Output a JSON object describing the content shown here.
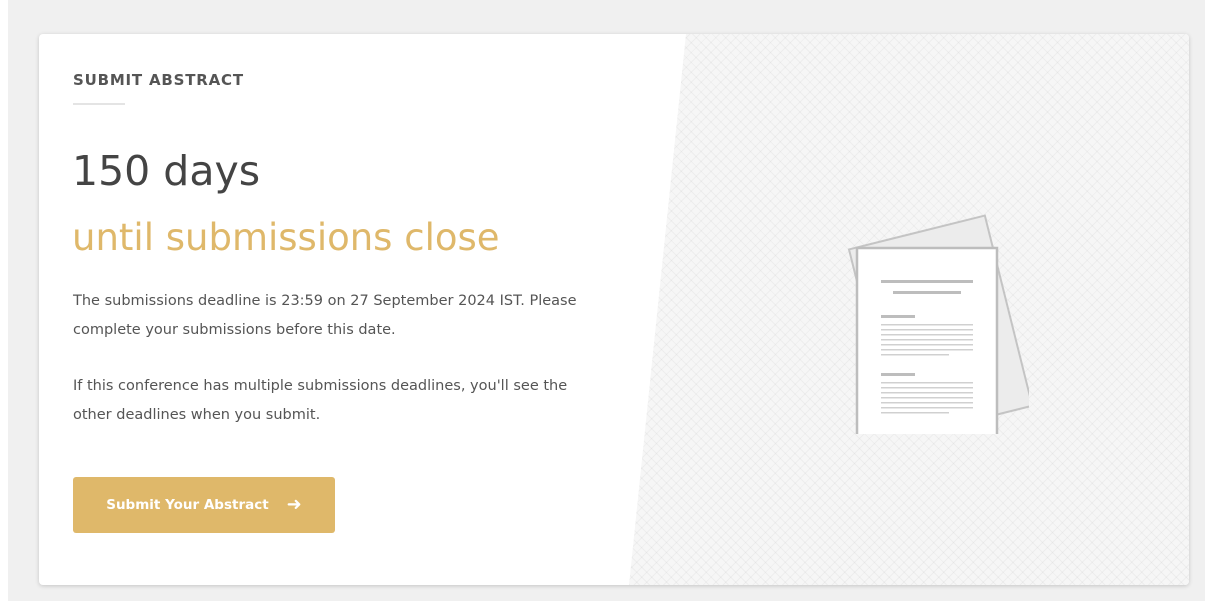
{
  "card": {
    "eyebrow": "SUBMIT ABSTRACT",
    "headline": "150 days",
    "subhead": "until submissions close",
    "paragraphs": [
      "The submissions deadline is 23:59 on 27 September 2024 IST. Please complete your submissions before this date.",
      "If this conference has multiple submissions deadlines, you'll see the other deadlines when you submit."
    ],
    "cta": {
      "label": "Submit Your Abstract",
      "icon": "arrow-right-icon"
    }
  },
  "illustration": {
    "icon": "document-stack-icon"
  },
  "colors": {
    "accent": "#dfb86a",
    "heading": "#444444",
    "body": "#555555",
    "page_bg": "#f0f0f0",
    "card_bg": "#ffffff"
  }
}
